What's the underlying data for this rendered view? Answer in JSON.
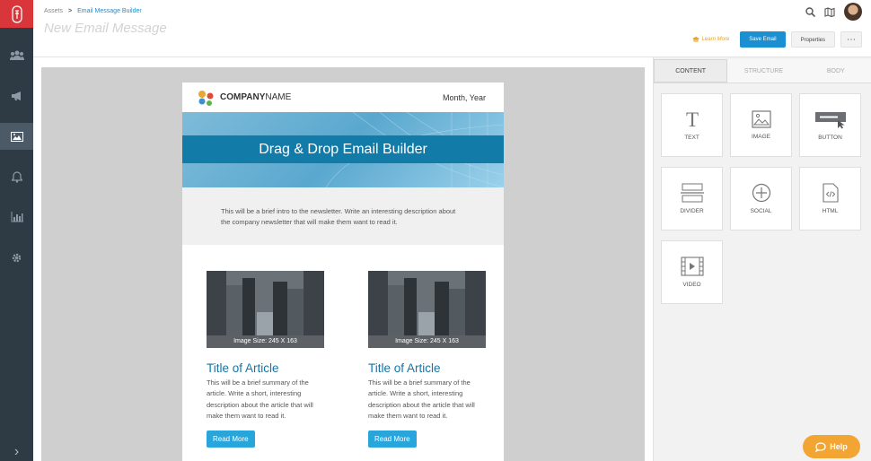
{
  "breadcrumb": {
    "root": "Assets",
    "separator": ">",
    "current": "Email Message Builder"
  },
  "page_title": "New Email Message",
  "header_actions": {
    "learn_more": "Learn More",
    "save": "Save Email",
    "properties": "Properties",
    "more": "⋯"
  },
  "nav": {
    "items": [
      "contacts-icon",
      "megaphone-icon",
      "image-icon",
      "bell-icon",
      "chart-icon",
      "gear-icon"
    ],
    "expand": "›"
  },
  "email": {
    "company_name_bold": "COMPANY",
    "company_name_rest": "NAME",
    "date": "Month, Year",
    "banner_title": "Drag & Drop Email Builder",
    "intro": "This will be a brief intro to the newsletter. Write an interesting description about the company newsletter that will make them want to read it.",
    "articles": [
      {
        "image_caption": "Image Size: 245 X 163",
        "title": "Title of Article",
        "summary": "This will be a brief summary of the article. Write a short, interesting description about the article that will make them want to read it.",
        "button": "Read More"
      },
      {
        "image_caption": "Image Size: 245 X 163",
        "title": "Title of Article",
        "summary": "This will be a brief summary of the article. Write a short, interesting description about the article that will make them want to read it.",
        "button": "Read More"
      }
    ]
  },
  "panel": {
    "tabs": [
      "CONTENT",
      "STRUCTURE",
      "BODY"
    ],
    "blocks": [
      "TEXT",
      "IMAGE",
      "BUTTON",
      "DIVIDER",
      "SOCIAL",
      "HTML",
      "VIDEO"
    ]
  },
  "help": "Help",
  "colors": {
    "accent": "#1a8fd1",
    "brand_red": "#d8363b",
    "rail": "#2e3a44",
    "help": "#f3a533"
  }
}
